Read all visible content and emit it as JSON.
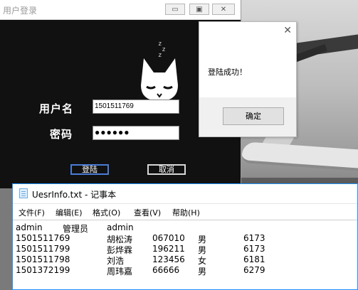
{
  "login_window": {
    "title": "用户登录",
    "username_label": "用户名",
    "password_label": "密码",
    "username_value": "1501511769",
    "password_mask": "●●●●●●",
    "login_button": "登陆",
    "cancel_button": "取消",
    "min_glyph": "▭",
    "max_glyph": "▣",
    "close_glyph": "✕"
  },
  "message_box": {
    "text": "登陆成功！",
    "ok_button": "确定",
    "close_glyph": "✕"
  },
  "notepad": {
    "title": "UesrInfo.txt - 记事本",
    "menu": [
      "文件(F)",
      "编辑(E)",
      "格式(O)",
      "查看(V)",
      "帮助(H)"
    ],
    "rows": [
      [
        "admin",
        "管理员",
        "admin",
        "",
        "",
        ""
      ],
      [
        "1501511769",
        "胡松涛",
        "067010",
        "男",
        "6173",
        ""
      ],
      [
        "1501511799",
        "彭烨霖",
        "196211",
        "男",
        "6173",
        ""
      ],
      [
        "1501511798",
        "刘浩",
        "123456",
        "女",
        "6181",
        ""
      ],
      [
        "1501372199",
        "周玮嘉",
        "66666",
        "男",
        "6279",
        ""
      ]
    ]
  }
}
